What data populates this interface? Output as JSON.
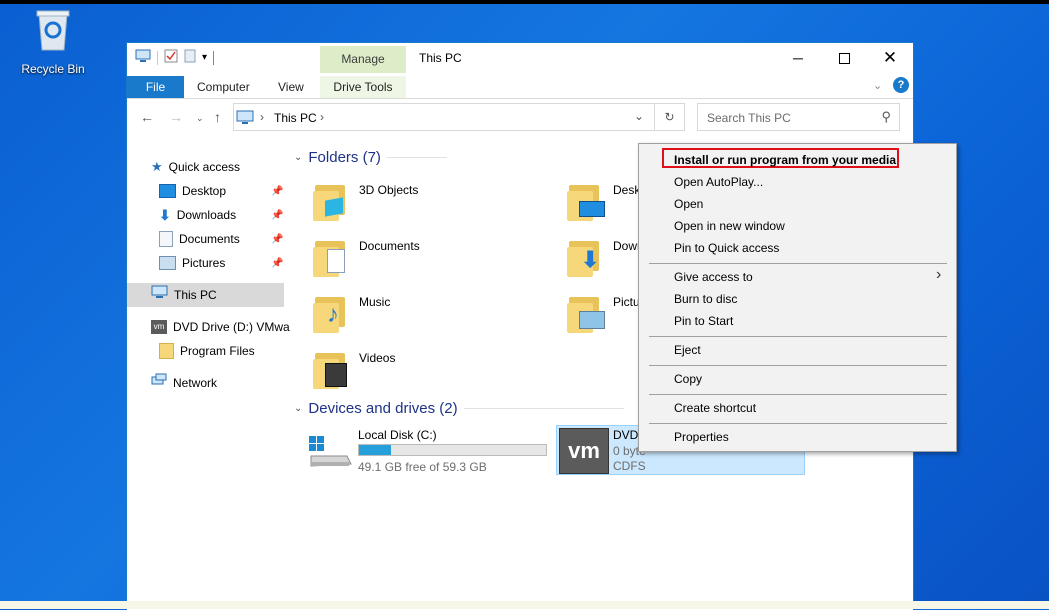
{
  "desktop": {
    "recycle_bin_label": "Recycle Bin"
  },
  "window": {
    "title": "This PC",
    "manage_tab": "Manage",
    "drive_tools_tab": "Drive Tools",
    "ribbon_tabs": [
      "File",
      "Computer",
      "View"
    ],
    "address_path": "This PC",
    "search_placeholder": "Search This PC"
  },
  "nav_pane": {
    "quick_access": "Quick access",
    "pinned": [
      "Desktop",
      "Downloads",
      "Documents",
      "Pictures"
    ],
    "this_pc": "This PC",
    "dvd_drive": "DVD Drive (D:) VMwa",
    "program_files": "Program Files",
    "network": "Network"
  },
  "content": {
    "folders_header": "Folders (7)",
    "folders": [
      "3D Objects",
      "Deskt",
      "Documents",
      "Down",
      "Music",
      "Pictu",
      "Videos"
    ],
    "devices_header": "Devices and drives (2)",
    "local_disk": {
      "name": "Local Disk (C:)",
      "free_text": "49.1 GB free of 59.3 GB",
      "used_fraction": 0.17
    },
    "dvd": {
      "name": "DVD",
      "line2": "0 byte",
      "fs": "CDFS",
      "logo_text": "vm"
    }
  },
  "context_menu": {
    "items": [
      "Install or run program from your media",
      "Open AutoPlay...",
      "Open",
      "Open in new window",
      "Pin to Quick access",
      "Give access to",
      "Burn to disc",
      "Pin to Start",
      "Eject",
      "Copy",
      "Create shortcut",
      "Properties"
    ],
    "submenu_arrow": "›"
  },
  "colors": {
    "accent": "#1979ca",
    "manage_green": "#dcedc8",
    "header_blue": "#1e3287",
    "highlight_red": "#e0101a"
  }
}
